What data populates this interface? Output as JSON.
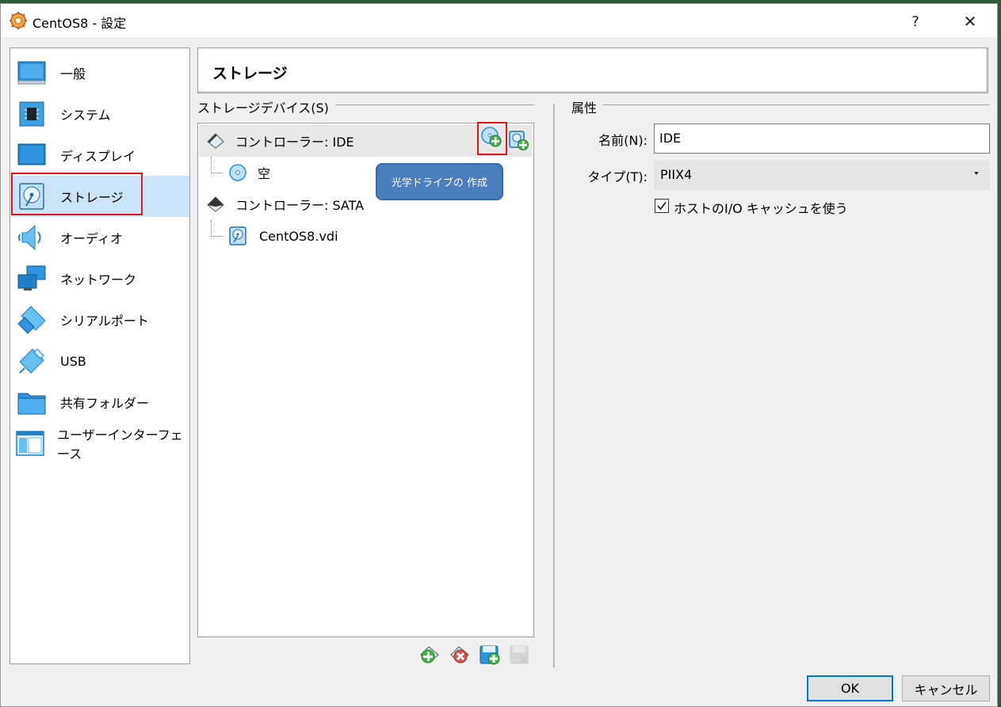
{
  "window": {
    "title": "CentOS8 - 設定",
    "help_label": "?",
    "close_label": "✕"
  },
  "sidebar": {
    "items": [
      {
        "label": "一般",
        "icon": "general-icon"
      },
      {
        "label": "システム",
        "icon": "system-chip-icon"
      },
      {
        "label": "ディスプレイ",
        "icon": "display-icon"
      },
      {
        "label": "ストレージ",
        "icon": "storage-disk-icon",
        "selected": true
      },
      {
        "label": "オーディオ",
        "icon": "audio-speaker-icon"
      },
      {
        "label": "ネットワーク",
        "icon": "network-icon"
      },
      {
        "label": "シリアルポート",
        "icon": "serial-port-icon"
      },
      {
        "label": "USB",
        "icon": "usb-icon"
      },
      {
        "label": "共有フォルダー",
        "icon": "shared-folder-icon"
      },
      {
        "label": "ユーザーインターフェース",
        "icon": "user-interface-icon"
      }
    ]
  },
  "page": {
    "title": "ストレージ"
  },
  "storage": {
    "group_title": "ストレージデバイス(S)",
    "tree": [
      {
        "label": "コントローラー: IDE",
        "kind": "controller"
      },
      {
        "label": "空",
        "kind": "optical"
      },
      {
        "label": "コントローラー: SATA",
        "kind": "controller"
      },
      {
        "label": "CentOS8.vdi",
        "kind": "disk"
      }
    ],
    "callout": "光学ドライブの 作成"
  },
  "attributes": {
    "group_title": "属性",
    "name_label": "名前(N):",
    "name_value": "IDE",
    "type_label": "タイプ(T):",
    "type_value": "PIIX4",
    "cache_label": "ホストのI/O キャッシュを使う",
    "cache_checked": true
  },
  "buttons": {
    "ok": "OK",
    "cancel": "キャンセル"
  },
  "colors": {
    "accent_red": "#e2141b",
    "selection": "#cce4f7",
    "callout": "#4a7ebd"
  }
}
